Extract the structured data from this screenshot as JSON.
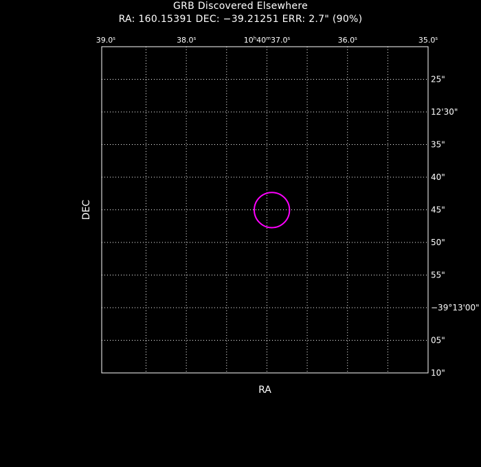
{
  "title": "GRB Discovered Elsewhere",
  "subtitle": "RA: 160.15391   DEC: −39.21251   ERR: 2.7\" (90%)",
  "colors": {
    "background": "#000000",
    "foreground": "#ffffff",
    "error_circle": "#ff00ff"
  },
  "chart_data": {
    "type": "scatter",
    "title": "GRB Discovered Elsewhere",
    "xlabel": "RA",
    "ylabel": "DEC",
    "grid": true,
    "x_ticks": [
      {
        "value_s": 39.0,
        "label": "39.0",
        "sup": "s",
        "prefix": "",
        "prefix_sup": ""
      },
      {
        "value_s": 38.0,
        "label": "38.0",
        "sup": "s",
        "prefix": "",
        "prefix_sup": ""
      },
      {
        "value_s": 37.0,
        "label": "40",
        "sup": "m",
        "prefix": "10",
        "prefix_sup": "h",
        "suffix": "37.0",
        "suffix_sup": "s"
      },
      {
        "value_s": 36.0,
        "label": "36.0",
        "sup": "s",
        "prefix": "",
        "prefix_sup": ""
      },
      {
        "value_s": 35.0,
        "label": "35.0",
        "sup": "s",
        "prefix": "",
        "prefix_sup": ""
      }
    ],
    "y_ticks": [
      {
        "value_arcsec": 25,
        "label": "25\""
      },
      {
        "value_arcsec": 30,
        "label": "12'30\""
      },
      {
        "value_arcsec": 35,
        "label": "35\""
      },
      {
        "value_arcsec": 40,
        "label": "40\""
      },
      {
        "value_arcsec": 45,
        "label": "45\""
      },
      {
        "value_arcsec": 50,
        "label": "50\""
      },
      {
        "value_arcsec": 55,
        "label": "55\""
      },
      {
        "value_arcsec": 60,
        "label": "−39°13'00\""
      },
      {
        "value_arcsec": 65,
        "label": "05\""
      },
      {
        "value_arcsec": 70,
        "label": "10\""
      }
    ],
    "x_range_s": [
      39.05,
      35.0
    ],
    "y_range_arcsec": [
      20,
      70
    ],
    "error_circle": {
      "ra_deg": 160.15391,
      "dec_deg": -39.21251,
      "radius_arcsec": 2.7,
      "confidence": "90%"
    }
  }
}
